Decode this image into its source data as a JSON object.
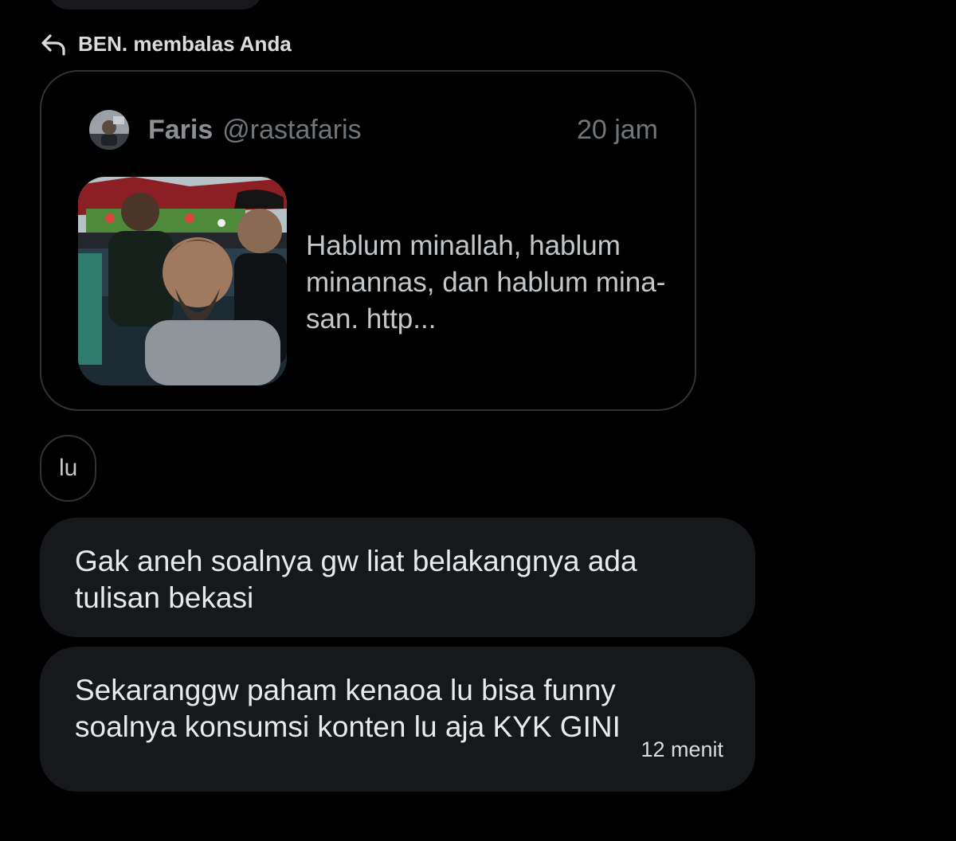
{
  "reply_header": {
    "label": "BEN. membalas Anda",
    "icon": "reply-arrow-icon"
  },
  "quoted_post": {
    "author_name": "Faris",
    "author_handle": "@rastafaris",
    "time": "20 jam",
    "text": "Hablum minallah, hablum minannas, dan hablum mina-san. http...",
    "thumbnail": "photo-thumbnail",
    "avatar": "avatar-image"
  },
  "messages": [
    {
      "text": "lu"
    },
    {
      "text": "Gak aneh soalnya gw liat belakangnya ada tulisan bekasi"
    },
    {
      "text": "Sekaranggw paham kenaoa lu bisa funny soalnya konsumsi konten lu aja KYK GINI",
      "time": "12 menit"
    }
  ],
  "colors": {
    "background": "#000000",
    "bubble": "#16181c",
    "border": "#2f3336",
    "muted_text": "#71767b",
    "text": "#e7e9ea"
  }
}
